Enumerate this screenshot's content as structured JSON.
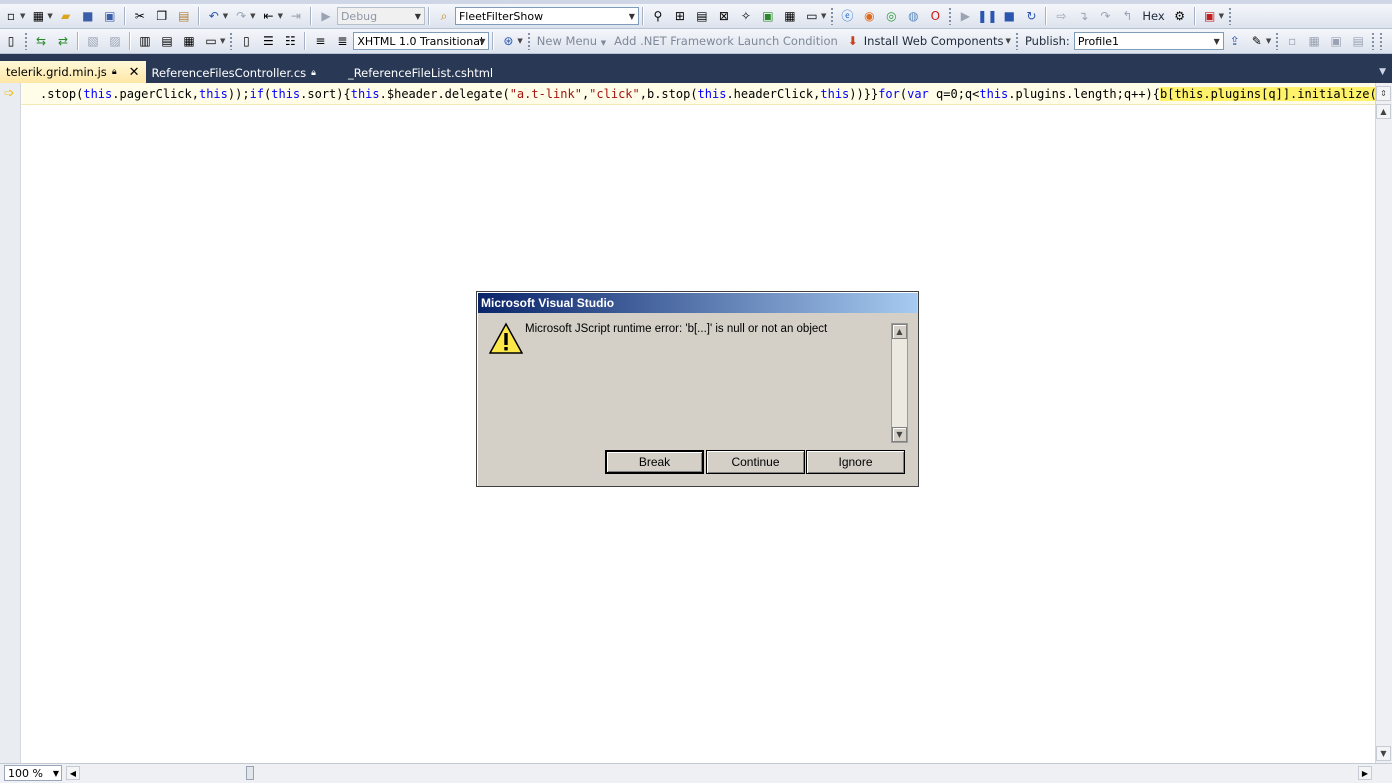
{
  "toolbar1": {
    "config_combo": "Debug",
    "find_combo": "FleetFilterShow",
    "hex_label": "Hex"
  },
  "toolbar2": {
    "doctype_combo": "XHTML 1.0 Transitional",
    "new_menu_label": "New Menu",
    "add_launch_condition_label": "Add .NET Framework Launch Condition",
    "install_web_components_label": "Install Web Components",
    "publish_label": "Publish:",
    "publish_profile": "Profile1"
  },
  "tabs": [
    {
      "label": "telerik.grid.min.js",
      "active": true
    },
    {
      "label": "ReferenceFilesController.cs",
      "active": false
    },
    {
      "label": "_ReferenceFileList.cshtml",
      "active": false
    }
  ],
  "editor": {
    "code_segments": [
      {
        "text": ".stop(",
        "kind": "plain"
      },
      {
        "text": "this",
        "kind": "kw"
      },
      {
        "text": ".pagerClick,",
        "kind": "plain"
      },
      {
        "text": "this",
        "kind": "kw"
      },
      {
        "text": "));",
        "kind": "plain"
      },
      {
        "text": "if",
        "kind": "kw"
      },
      {
        "text": "(",
        "kind": "plain"
      },
      {
        "text": "this",
        "kind": "kw"
      },
      {
        "text": ".sort){",
        "kind": "plain"
      },
      {
        "text": "this",
        "kind": "kw"
      },
      {
        "text": ".$header.delegate(",
        "kind": "plain"
      },
      {
        "text": "\"a.t-link\"",
        "kind": "str"
      },
      {
        "text": ",",
        "kind": "plain"
      },
      {
        "text": "\"click\"",
        "kind": "str"
      },
      {
        "text": ",b.stop(",
        "kind": "plain"
      },
      {
        "text": "this",
        "kind": "kw"
      },
      {
        "text": ".headerClick,",
        "kind": "plain"
      },
      {
        "text": "this",
        "kind": "kw"
      },
      {
        "text": "))}}",
        "kind": "plain"
      },
      {
        "text": "for",
        "kind": "kw"
      },
      {
        "text": "(",
        "kind": "plain"
      },
      {
        "text": "var",
        "kind": "kw"
      },
      {
        "text": " q=0;q<",
        "kind": "plain"
      },
      {
        "text": "this",
        "kind": "kw"
      },
      {
        "text": ".plugins.length;q++){",
        "kind": "plain"
      },
      {
        "text": "b[this.plugins[q]].initialize(this)",
        "kind": "hl"
      }
    ]
  },
  "statusbar": {
    "zoom": "100 %"
  },
  "dialog": {
    "title": "Microsoft Visual Studio",
    "message": "Microsoft JScript runtime error: 'b[...]' is null or not an object",
    "buttons": {
      "break": "Break",
      "continue": "Continue",
      "ignore": "Ignore"
    }
  },
  "colors": {
    "ide_background": "#293955",
    "active_tab": "#ffe8a6",
    "highlight": "#fff26b",
    "keyword": "#0000ff",
    "string": "#a31515",
    "dialog_face": "#d4d0c8",
    "dialog_title_start": "#0a246a"
  }
}
